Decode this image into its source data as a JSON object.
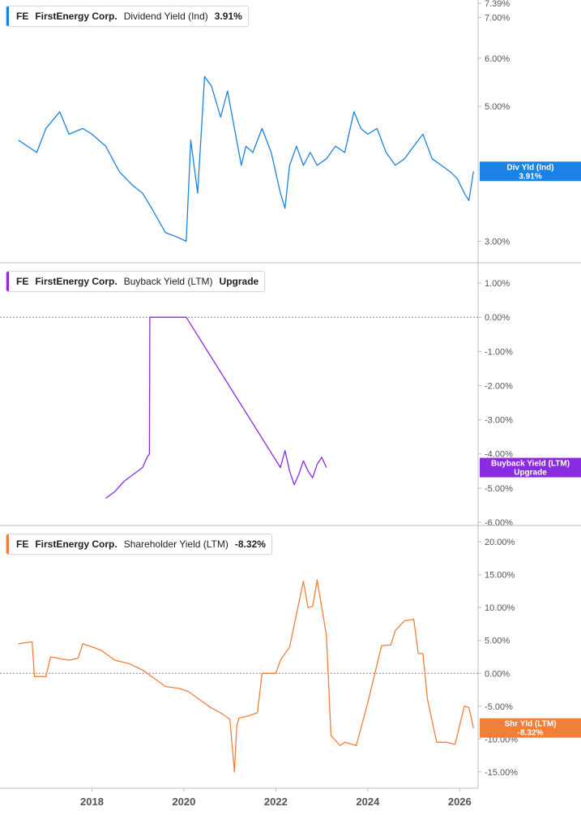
{
  "legends": [
    {
      "ticker": "FE",
      "company": "FirstEnergy Corp.",
      "metric": "Dividend Yield (Ind)",
      "value": "3.91%"
    },
    {
      "ticker": "FE",
      "company": "FirstEnergy Corp.",
      "metric": "Buyback Yield (LTM)",
      "value": "Upgrade"
    },
    {
      "ticker": "FE",
      "company": "FirstEnergy Corp.",
      "metric": "Shareholder Yield (LTM)",
      "value": "-8.32%"
    }
  ],
  "colors": {
    "dividend": "#1a82e2",
    "buyback": "#8a2be2",
    "shareholder": "#f07f3c",
    "grid": "#cfcfcf",
    "axis_text": "#555555"
  },
  "chart_data": [
    {
      "type": "line",
      "series": [
        {
          "name": "Dividend Yield (Ind)",
          "color": "#1a82e2",
          "x": [
            2016.4,
            2016.8,
            2017.0,
            2017.3,
            2017.5,
            2017.8,
            2018.0,
            2018.3,
            2018.6,
            2018.9,
            2019.1,
            2019.3,
            2019.6,
            2019.85,
            2020.05,
            2020.15,
            2020.3,
            2020.45,
            2020.6,
            2020.8,
            2020.95,
            2021.1,
            2021.25,
            2021.35,
            2021.5,
            2021.7,
            2021.9,
            2022.1,
            2022.2,
            2022.3,
            2022.45,
            2022.6,
            2022.75,
            2022.9,
            2023.1,
            2023.3,
            2023.5,
            2023.7,
            2023.85,
            2024.0,
            2024.2,
            2024.4,
            2024.6,
            2024.8,
            2025.0,
            2025.2,
            2025.4,
            2025.6,
            2025.8,
            2025.95,
            2026.1,
            2026.2,
            2026.3
          ],
          "values": [
            4.4,
            4.2,
            4.6,
            4.9,
            4.5,
            4.6,
            4.5,
            4.3,
            3.9,
            3.7,
            3.6,
            3.4,
            3.1,
            3.05,
            3.0,
            4.4,
            3.6,
            5.6,
            5.4,
            4.8,
            5.3,
            4.6,
            4.0,
            4.3,
            4.2,
            4.6,
            4.2,
            3.6,
            3.4,
            4.0,
            4.3,
            4.0,
            4.2,
            4.0,
            4.1,
            4.3,
            4.2,
            4.9,
            4.6,
            4.5,
            4.6,
            4.2,
            4.0,
            4.1,
            4.3,
            4.5,
            4.1,
            4.0,
            3.9,
            3.8,
            3.6,
            3.5,
            3.91
          ]
        }
      ],
      "title": "",
      "xlabel": "",
      "ylabel": "",
      "ylim": [
        2.8,
        7.39
      ],
      "yscale": "log",
      "yticks": [
        "7.39%",
        "7.00%",
        "6.00%",
        "5.00%",
        "3.00%"
      ],
      "current_label": {
        "title": "Div Yld (Ind)",
        "value": "3.91%"
      }
    },
    {
      "type": "line",
      "series": [
        {
          "name": "Buyback Yield (LTM)",
          "color": "#8a2be2",
          "x": [
            2018.3,
            2018.5,
            2018.7,
            2018.9,
            2019.1,
            2019.2,
            2019.25,
            2019.26,
            2019.5,
            2019.75,
            2020.05,
            2022.1,
            2022.2,
            2022.3,
            2022.4,
            2022.5,
            2022.6,
            2022.7,
            2022.8,
            2022.9,
            2023.0,
            2023.1
          ],
          "values": [
            -5.3,
            -5.1,
            -4.8,
            -4.6,
            -4.4,
            -4.1,
            -4.0,
            0.0,
            0.0,
            0.0,
            0.0,
            -4.4,
            -3.9,
            -4.5,
            -4.9,
            -4.6,
            -4.2,
            -4.5,
            -4.7,
            -4.3,
            -4.1,
            -4.4
          ]
        }
      ],
      "title": "",
      "xlabel": "",
      "ylabel": "",
      "ylim": [
        -6.0,
        1.5
      ],
      "yticks": [
        "1.00%",
        "0.00%",
        "-1.00%",
        "-2.00%",
        "-3.00%",
        "-4.00%",
        "-5.00%",
        "-6.00%"
      ],
      "current_label": {
        "title": "Buyback Yield (LTM)",
        "value": "Upgrade"
      }
    },
    {
      "type": "line",
      "series": [
        {
          "name": "Shareholder Yield (LTM)",
          "color": "#f07f3c",
          "x": [
            2016.4,
            2016.7,
            2016.75,
            2017.0,
            2017.1,
            2017.5,
            2017.7,
            2017.8,
            2018.0,
            2018.2,
            2018.5,
            2018.8,
            2019.1,
            2019.4,
            2019.6,
            2019.9,
            2020.1,
            2020.3,
            2020.6,
            2020.8,
            2021.0,
            2021.1,
            2021.15,
            2021.2,
            2021.4,
            2021.6,
            2021.7,
            2022.0,
            2022.1,
            2022.3,
            2022.6,
            2022.7,
            2022.8,
            2022.9,
            2023.1,
            2023.2,
            2023.4,
            2023.5,
            2023.75,
            2024.0,
            2024.3,
            2024.5,
            2024.6,
            2024.8,
            2025.0,
            2025.1,
            2025.2,
            2025.3,
            2025.5,
            2025.7,
            2025.9,
            2026.1,
            2026.2,
            2026.3
          ],
          "values": [
            4.5,
            4.8,
            -0.5,
            -0.5,
            2.5,
            2.0,
            2.3,
            4.5,
            4.0,
            3.5,
            2.0,
            1.5,
            0.5,
            -1.0,
            -2.0,
            -2.3,
            -2.8,
            -3.8,
            -5.3,
            -6.0,
            -7.0,
            -15.0,
            -8.0,
            -6.8,
            -6.5,
            -6.0,
            0.0,
            0.0,
            2.0,
            4.0,
            14.0,
            10.0,
            10.2,
            14.2,
            5.8,
            -9.5,
            -11.0,
            -10.5,
            -11.0,
            -4.5,
            4.2,
            4.3,
            6.5,
            8.0,
            8.2,
            3.0,
            3.0,
            -4.0,
            -10.5,
            -10.5,
            -10.8,
            -5.0,
            -5.2,
            -8.32
          ]
        }
      ],
      "title": "",
      "xlabel": "",
      "ylabel": "",
      "ylim": [
        -17.0,
        22.0
      ],
      "yticks": [
        "20.00%",
        "15.00%",
        "10.00%",
        "5.00%",
        "0.00%",
        "-5.00%",
        "-10.00%",
        "-15.00%"
      ],
      "current_label": {
        "title": "Shr Yld (LTM)",
        "value": "-8.32%"
      }
    }
  ],
  "x_axis": {
    "type": "date",
    "xlim": [
      2016.0,
      2026.4
    ],
    "ticks": [
      "2018",
      "2020",
      "2022",
      "2024",
      "2026"
    ]
  }
}
